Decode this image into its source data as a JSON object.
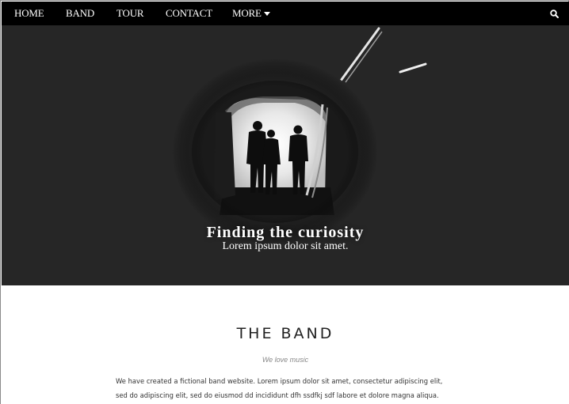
{
  "nav": {
    "items": [
      {
        "label": "HOME"
      },
      {
        "label": "BAND"
      },
      {
        "label": "TOUR"
      },
      {
        "label": "CONTACT"
      },
      {
        "label": "MORE"
      }
    ],
    "search_icon": "search-icon",
    "more_icon": "caret-down-icon"
  },
  "hero": {
    "title": "Finding the curiosity",
    "subtitle": "Lorem ipsum dolor sit amet."
  },
  "band": {
    "title": "THE BAND",
    "tagline": "We love music",
    "text_lines": [
      "We have created a fictional band website. Lorem ipsum dolor sit amet, consectetur adipiscing elit,",
      "sed do adipiscing elit, sed do eiusmod dd incididunt dfh ssdfkj sdf labore et dolore magna aliqua."
    ]
  },
  "colors": {
    "nav_background": "#000000",
    "hero_background": "#262626",
    "page_background": "#ffffff"
  }
}
